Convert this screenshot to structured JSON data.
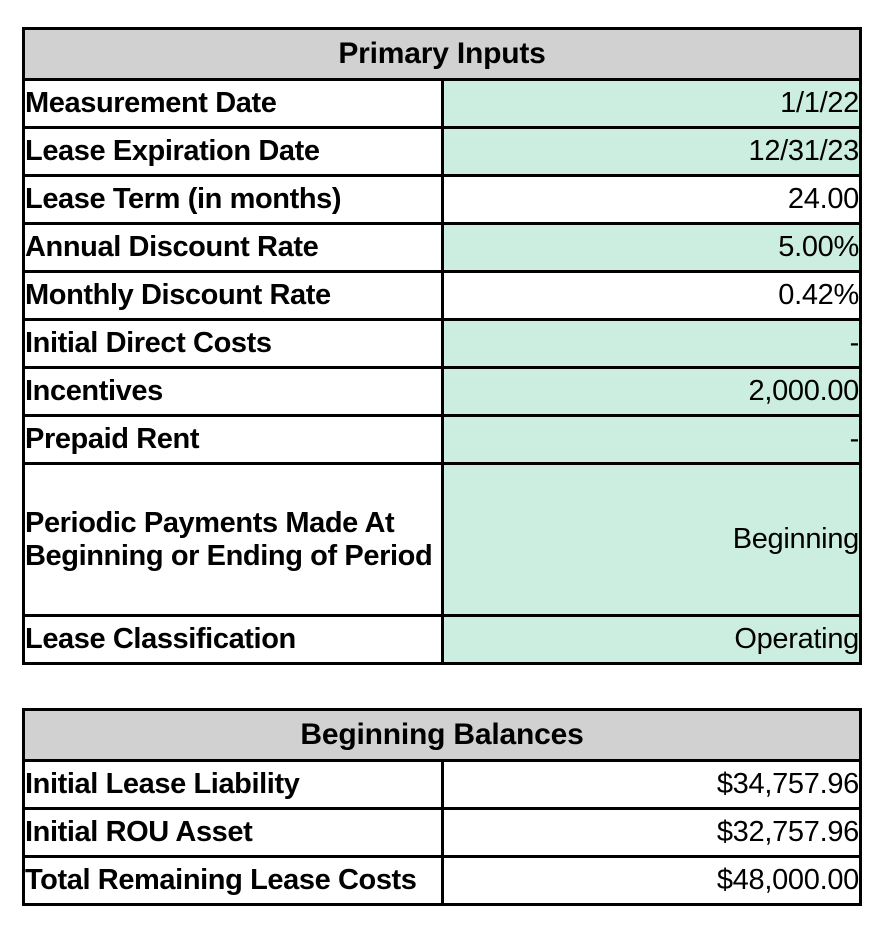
{
  "colors": {
    "header_gray": "#d1d1d1",
    "input_green": "#cceee0",
    "border": "#000000",
    "text": "#000000",
    "page_background": "#ffffff"
  },
  "primary_inputs": {
    "title": "Primary Inputs",
    "rows": [
      {
        "label": "Measurement Date",
        "value": "1/1/22",
        "highlighted": true
      },
      {
        "label": "Lease Expiration Date",
        "value": "12/31/23",
        "highlighted": true
      },
      {
        "label": "Lease Term (in months)",
        "value": "24.00",
        "highlighted": false
      },
      {
        "label": "Annual Discount Rate",
        "value": "5.00%",
        "highlighted": true
      },
      {
        "label": "Monthly Discount Rate",
        "value": "0.42%",
        "highlighted": false
      },
      {
        "label": "Initial Direct Costs",
        "value": "-",
        "highlighted": true
      },
      {
        "label": "Incentives",
        "value": "2,000.00",
        "highlighted": true
      },
      {
        "label": "Prepaid Rent",
        "value": "-",
        "highlighted": true
      },
      {
        "label": "Periodic Payments Made At Beginning or Ending of Period",
        "label_line1": "Periodic Payments Made At",
        "label_line2": "Beginning or Ending of Period",
        "value": "Beginning",
        "highlighted": true,
        "tall": true
      },
      {
        "label": "Lease Classification",
        "value": "Operating",
        "highlighted": true
      }
    ]
  },
  "beginning_balances": {
    "title": "Beginning Balances",
    "rows": [
      {
        "label": "Initial Lease Liability",
        "value": "$34,757.96",
        "highlighted": false
      },
      {
        "label": "Initial ROU Asset",
        "value": "$32,757.96",
        "highlighted": false
      },
      {
        "label": "Total Remaining Lease Costs",
        "value": "$48,000.00",
        "highlighted": false
      }
    ]
  }
}
